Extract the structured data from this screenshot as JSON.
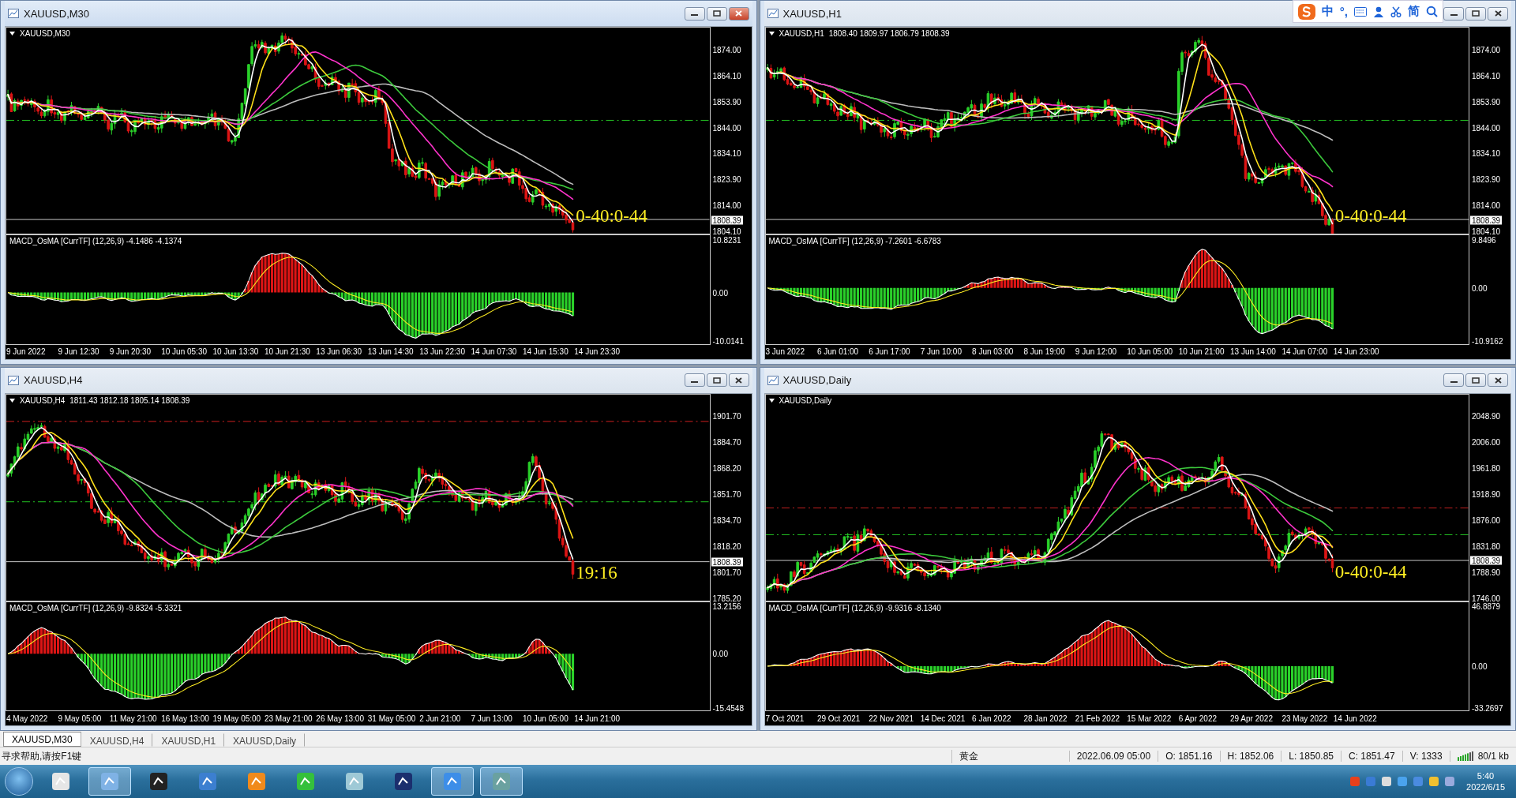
{
  "windows": [
    {
      "title": "XAUUSD,M30",
      "selected": true,
      "symbol_label": "XAUUSD,M30",
      "price_ticks": [
        "1874.00",
        "1864.10",
        "1853.90",
        "1844.00",
        "1834.10",
        "1823.90",
        "1814.00",
        "1804.10"
      ],
      "current_price": "1808.39",
      "countdown": "0-40:0-44",
      "macd_label": "MACD_OsMA [CurrTF] (12,26,9) -4.1486 -4.1374",
      "macd_ticks": [
        "10.8231",
        "0.00",
        "-10.0141"
      ],
      "time_labels": [
        "9 Jun 2022",
        "9 Jun 12:30",
        "9 Jun 20:30",
        "10 Jun 05:30",
        "10 Jun 13:30",
        "10 Jun 21:30",
        "13 Jun 06:30",
        "13 Jun 14:30",
        "13 Jun 22:30",
        "14 Jun 07:30",
        "14 Jun 15:30",
        "14 Jun 23:30"
      ]
    },
    {
      "title": "XAUUSD,H1",
      "selected": false,
      "symbol_label": "XAUUSD,H1",
      "ohlc": "1808.40 1809.97 1806.79 1808.39",
      "price_ticks": [
        "1874.00",
        "1864.10",
        "1853.90",
        "1844.00",
        "1834.10",
        "1823.90",
        "1814.00",
        "1804.10"
      ],
      "current_price": "1808.39",
      "countdown": "0-40:0-44",
      "macd_label": "MACD_OsMA [CurrTF] (12,26,9) -7.2601 -6.6783",
      "macd_ticks": [
        "9.8496",
        "0.00",
        "-10.9162"
      ],
      "time_labels": [
        "3 Jun 2022",
        "6 Jun 01:00",
        "6 Jun 17:00",
        "7 Jun 10:00",
        "8 Jun 03:00",
        "8 Jun 19:00",
        "9 Jun 12:00",
        "10 Jun 05:00",
        "10 Jun 21:00",
        "13 Jun 14:00",
        "14 Jun 07:00",
        "14 Jun 23:00"
      ]
    },
    {
      "title": "XAUUSD,H4",
      "selected": false,
      "symbol_label": "XAUUSD,H4",
      "ohlc": "1811.43 1812.18 1805.14 1808.39",
      "price_ticks": [
        "1901.70",
        "1884.70",
        "1868.20",
        "1851.70",
        "1834.70",
        "1818.20",
        "1801.70",
        "1785.20"
      ],
      "current_price": "1808.39",
      "countdown": "19:16",
      "macd_label": "MACD_OsMA [CurrTF] (12,26,9) -9.8324 -5.3321",
      "macd_ticks": [
        "13.2156",
        "0.00",
        "-15.4548"
      ],
      "time_labels": [
        "4 May 2022",
        "9 May 05:00",
        "11 May 21:00",
        "16 May 13:00",
        "19 May 05:00",
        "23 May 21:00",
        "26 May 13:00",
        "31 May 05:00",
        "2 Jun 21:00",
        "7 Jun 13:00",
        "10 Jun 05:00",
        "14 Jun 21:00"
      ]
    },
    {
      "title": "XAUUSD,Daily",
      "selected": false,
      "symbol_label": "XAUUSD,Daily",
      "price_ticks": [
        "2048.90",
        "2006.00",
        "1961.80",
        "1918.90",
        "1876.00",
        "1831.80",
        "1788.90",
        "1746.00"
      ],
      "current_price": "1808.39",
      "countdown": "0-40:0-44",
      "macd_label": "MACD_OsMA [CurrTF] (12,26,9) -9.9316 -8.1340",
      "macd_ticks": [
        "46.8879",
        "0.00",
        "-33.2697"
      ],
      "time_labels": [
        "7 Oct 2021",
        "29 Oct 2021",
        "22 Nov 2021",
        "14 Dec 2021",
        "6 Jan 2022",
        "28 Jan 2022",
        "21 Feb 2022",
        "15 Mar 2022",
        "6 Apr 2022",
        "29 Apr 2022",
        "23 May 2022",
        "14 Jun 2022"
      ]
    }
  ],
  "tabs": [
    {
      "label": "XAUUSD,M30",
      "selected": true
    },
    {
      "label": "XAUUSD,H4",
      "selected": false
    },
    {
      "label": "XAUUSD,H1",
      "selected": false
    },
    {
      "label": "XAUUSD,Daily",
      "selected": false
    }
  ],
  "status_bar": {
    "help": "寻求帮助,请按F1键",
    "symbol": "黄金",
    "fields": [
      "2022.06.09 05:00",
      "O: 1851.16",
      "H: 1852.06",
      "L: 1850.85",
      "C: 1851.47",
      "V: 1333"
    ],
    "traffic": "80/1 kb"
  },
  "ime_toolbar": {
    "labels": [
      "中",
      "°,",
      "简"
    ]
  },
  "taskbar": {
    "time": "5:40",
    "date": "2022/6/15"
  }
}
